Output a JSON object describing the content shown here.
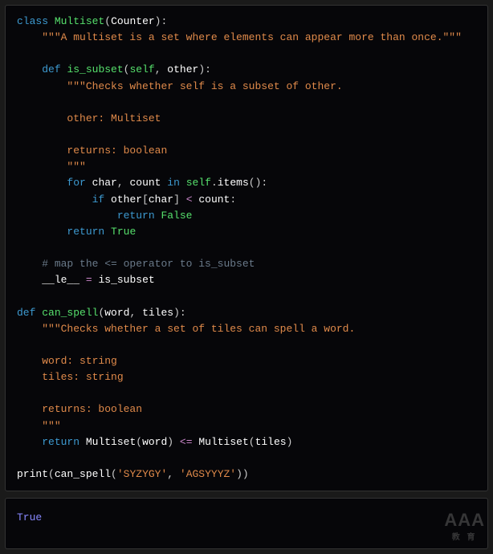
{
  "code": {
    "line1_kw_class": "class",
    "line1_cls": "Multiset",
    "line1_base": "Counter",
    "line2_doc": "\"\"\"A multiset is a set where elements can appear more than once.\"\"\"",
    "line4_kw_def": "def",
    "line4_fn": "is_subset",
    "line4_self": "self",
    "line4_other": "other",
    "line5_doc": "\"\"\"Checks whether self is a subset of other.",
    "line7_doc": "other: Multiset",
    "line9_doc": "returns: boolean",
    "line10_doc": "\"\"\"",
    "line11_for": "for",
    "line11_char": "char",
    "line11_count": "count",
    "line11_in": "in",
    "line11_self": "self",
    "line11_items": "items",
    "line12_if": "if",
    "line12_other": "other",
    "line12_char": "char",
    "line12_lt": "<",
    "line12_count": "count",
    "line13_return": "return",
    "line13_false": "False",
    "line14_return": "return",
    "line14_true": "True",
    "line16_comment": "# map the <= operator to is_subset",
    "line17_le": "__le__",
    "line17_eq": "=",
    "line17_is_subset": "is_subset",
    "line19_def": "def",
    "line19_fn": "can_spell",
    "line19_word": "word",
    "line19_tiles": "tiles",
    "line20_doc": "\"\"\"Checks whether a set of tiles can spell a word.",
    "line22_doc": "word: string",
    "line23_doc": "tiles: string",
    "line25_doc": "returns: boolean",
    "line26_doc": "\"\"\"",
    "line27_return": "return",
    "line27_ms1": "Multiset",
    "line27_word": "word",
    "line27_op": "<=",
    "line27_ms2": "Multiset",
    "line27_tiles": "tiles",
    "line29_print": "print",
    "line29_can_spell": "can_spell",
    "line29_arg1": "'SYZYGY'",
    "line29_arg2": "'AGSYYYZ'"
  },
  "output": "True",
  "watermark": {
    "main": "AAA",
    "sub": "教 育"
  }
}
